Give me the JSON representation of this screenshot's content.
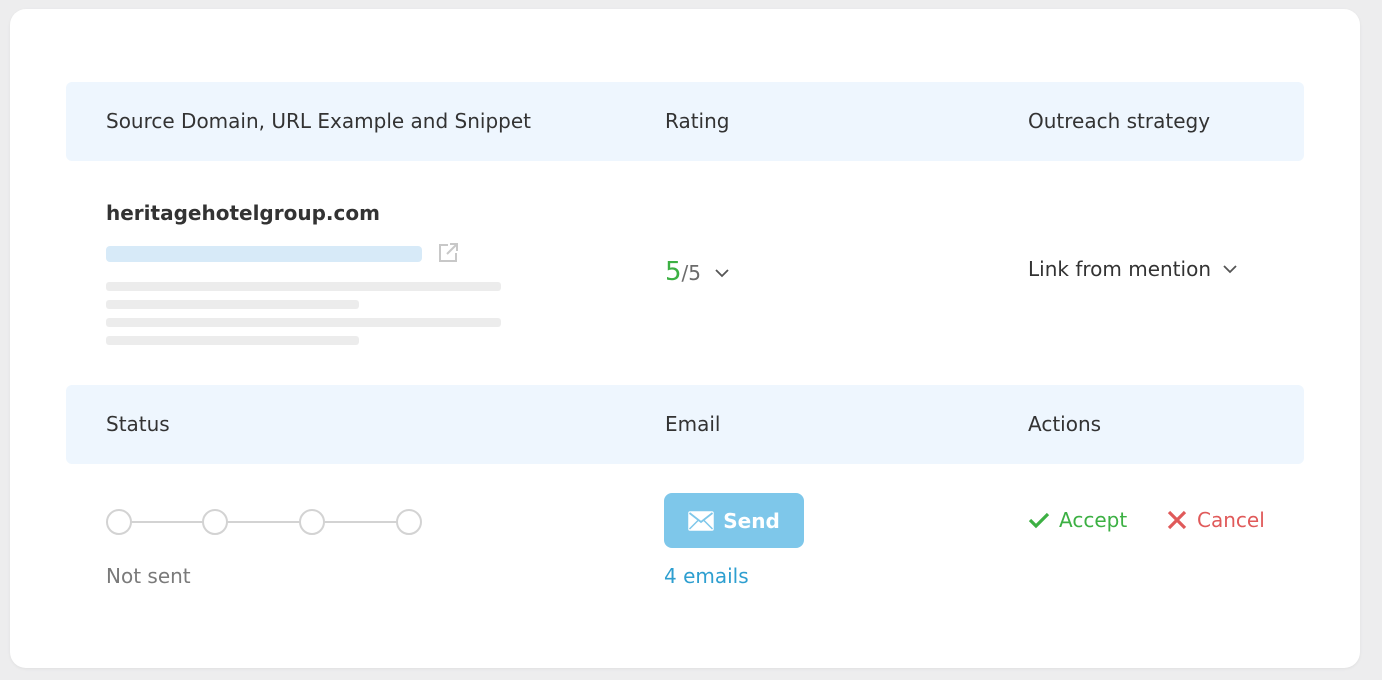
{
  "colors": {
    "header_bg": "#eef6fe",
    "rating_green": "#3cb043",
    "url_bar": "#d7eaf8",
    "send_button": "#7ec7ea",
    "link_blue": "#2e9fd0",
    "accept_green": "#3cb043",
    "cancel_red": "#e05a5a"
  },
  "table": {
    "headers_top": {
      "source": "Source Domain, URL Example and Snippet",
      "rating": "Rating",
      "strategy": "Outreach strategy"
    },
    "headers_bottom": {
      "status": "Status",
      "email": "Email",
      "actions": "Actions"
    }
  },
  "row": {
    "domain": "heritagehotelgroup.com",
    "url_icon": "external-link-icon",
    "rating": {
      "value": "5",
      "separator": "/",
      "max": "5",
      "dropdown_icon": "chevron-down-icon"
    },
    "strategy": {
      "value": "Link from mention",
      "dropdown_icon": "chevron-down-icon"
    },
    "status": {
      "steps_total": 4,
      "steps_completed": 0,
      "text": "Not sent"
    },
    "email": {
      "send_label": "Send",
      "send_icon": "envelope-icon",
      "count_label": "4 emails"
    },
    "actions": {
      "accept_label": "Accept",
      "accept_icon": "checkmark-icon",
      "cancel_label": "Cancel",
      "cancel_icon": "close-icon"
    }
  }
}
